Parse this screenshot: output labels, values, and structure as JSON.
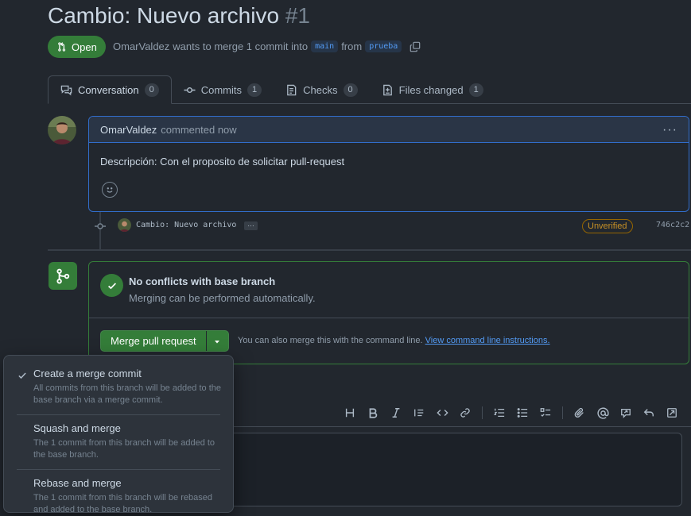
{
  "pr": {
    "title": "Cambio: Nuevo archivo",
    "number": "#1",
    "state": "Open",
    "author": "OmarValdez",
    "merge_text": "wants to merge 1 commit into",
    "base_branch": "main",
    "from_text": "from",
    "head_branch": "prueba"
  },
  "tabs": [
    {
      "label": "Conversation",
      "count": "0",
      "icon": "conversation-icon"
    },
    {
      "label": "Commits",
      "count": "1",
      "icon": "commit-icon"
    },
    {
      "label": "Checks",
      "count": "0",
      "icon": "checks-icon"
    },
    {
      "label": "Files changed",
      "count": "1",
      "icon": "file-diff-icon"
    }
  ],
  "comment": {
    "author": "OmarValdez",
    "time": "commented now",
    "body": "Descripción: Con el proposito de solicitar pull-request",
    "menu": "···"
  },
  "commit": {
    "message": "Cambio: Nuevo archivo",
    "ellipsis": "…",
    "badge": "Unverified",
    "sha": "746c2c2"
  },
  "merge": {
    "title": "No conflicts with base branch",
    "subtitle": "Merging can be performed automatically.",
    "button": "Merge pull request",
    "hint": "You can also merge this with the command line.",
    "hint_link": "View command line instructions."
  },
  "merge_options": [
    {
      "title": "Create a merge commit",
      "desc": "All commits from this branch will be added to the base branch via a merge commit.",
      "selected": true
    },
    {
      "title": "Squash and merge",
      "desc": "The 1 commit from this branch will be added to the base branch.",
      "selected": false
    },
    {
      "title": "Rebase and merge",
      "desc": "The 1 commit from this branch will be rebased and added to the base branch.",
      "selected": false
    }
  ],
  "toolbar_icons": [
    "heading-icon",
    "bold-icon",
    "italic-icon",
    "quote-icon",
    "code-icon",
    "link-icon",
    "ordered-list-icon",
    "unordered-list-icon",
    "task-list-icon",
    "attach-icon",
    "mention-icon",
    "reference-icon",
    "reply-icon",
    "fullscreen-icon"
  ],
  "colors": {
    "accent_green": "#347d39",
    "link_blue": "#539bf5",
    "warning": "#c69026"
  }
}
